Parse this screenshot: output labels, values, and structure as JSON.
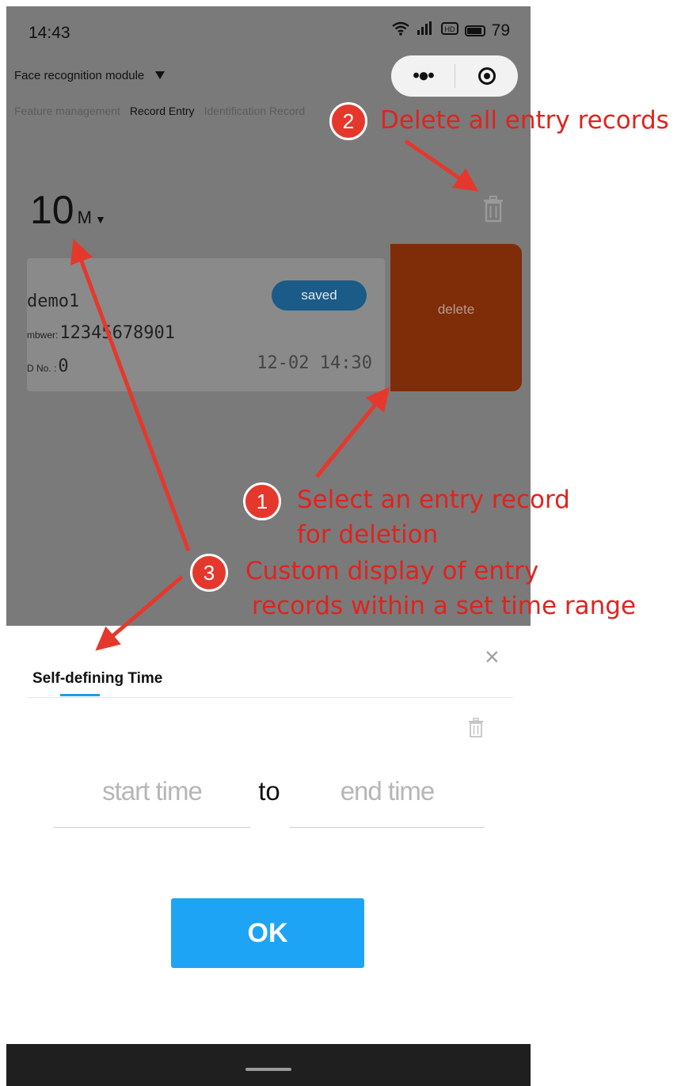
{
  "status_bar": {
    "time": "14:43",
    "battery": "79"
  },
  "header": {
    "module_title": "Face recognition module",
    "tabs": [
      {
        "label": "Feature management"
      },
      {
        "label": "Record Entry"
      },
      {
        "label": "Identification Record"
      }
    ]
  },
  "range_selector": {
    "value": "10",
    "unit": "M"
  },
  "record": {
    "name": "demo1",
    "number_label": "mbwer:",
    "number": "12345678901",
    "id_label": "D No. :",
    "id": "0",
    "status_badge": "saved",
    "time": "12-02 14:30",
    "delete_label": "delete"
  },
  "sheet": {
    "title": "Self-defining Time",
    "start_placeholder": "start time",
    "to_label": "to",
    "end_placeholder": "end time",
    "ok_label": "OK",
    "close_symbol": "×"
  },
  "annotations": [
    {
      "num": "1",
      "line1": "Select an entry record",
      "line2": "for deletion"
    },
    {
      "num": "2",
      "line1": "Delete all entry records"
    },
    {
      "num": "3",
      "line1": "Custom display of entry",
      "line2": "records within a set time range"
    }
  ],
  "colors": {
    "accent": "#1ea4f5",
    "delete": "#7f2c09",
    "annotation": "#e0231d"
  }
}
